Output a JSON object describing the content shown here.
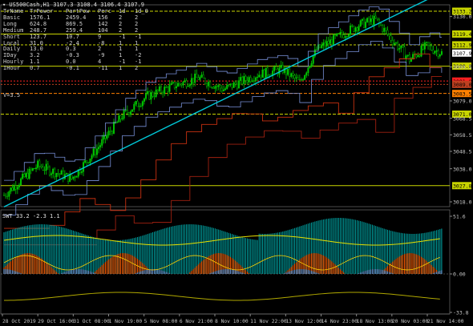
{
  "window": {
    "title": "▾ US500Cash,H1  3107.3 3108.4 3106.4 3107.9"
  },
  "info_table": {
    "headers": [
      "TrName",
      "TrPower",
      "PartPow",
      "Perc",
      "1d",
      "1d_0"
    ],
    "rows": [
      [
        "Basic",
        "1576.1",
        "2459.4",
        "156",
        "2",
        "2"
      ],
      [
        "Long",
        "624.8",
        "869.5",
        "142",
        "2",
        "2"
      ],
      [
        "Medium",
        "248.7",
        "259.4",
        "104",
        "2",
        "2"
      ],
      [
        "Short",
        "123.7",
        "10.7",
        "9",
        "-1",
        "-1"
      ],
      [
        "Local",
        "31.0",
        "-2.4",
        "-8",
        "1",
        "1"
      ],
      [
        "Daily",
        "13.0",
        "0.3",
        "2",
        "1",
        "1"
      ],
      [
        "IDay",
        "3.2",
        "-0.3",
        "-9",
        "1",
        "-2"
      ],
      [
        "Hourly",
        "1.1",
        "0.0",
        "4",
        "-1",
        "-1"
      ],
      [
        "IHour",
        "0.7",
        "-0.1",
        "-11",
        "1",
        "2"
      ]
    ],
    "footer": "V=3.5"
  },
  "price_labels": [
    {
      "text": "3133.2",
      "color": "#c8d400",
      "kind": "box"
    },
    {
      "text": "3130.0",
      "color": "#c8c8c8",
      "kind": "plain"
    },
    {
      "text": "3119.4",
      "color": "#c8d400",
      "kind": "box"
    },
    {
      "text": "3112.9",
      "color": "#c8d400",
      "kind": "box"
    },
    {
      "text": "3107.9",
      "color": "#ffffff",
      "kind": "box"
    },
    {
      "text": "3100.0",
      "color": "#c8d400",
      "kind": "box"
    },
    {
      "text": "3099.5",
      "color": "#c8c8c8",
      "kind": "plain"
    },
    {
      "text": "3091.0",
      "color": "#ff2020",
      "kind": "box"
    },
    {
      "text": "3089.0",
      "color": "#c04020",
      "kind": "box"
    },
    {
      "text": "3083.5",
      "color": "#ff8000",
      "kind": "box"
    },
    {
      "text": "3079.0",
      "color": "#c8c8c8",
      "kind": "plain"
    },
    {
      "text": "3071.0",
      "color": "#c8d400",
      "kind": "box"
    },
    {
      "text": "3068.5",
      "color": "#c8c8c8",
      "kind": "plain"
    },
    {
      "text": "3058.5",
      "color": "#c8c8c8",
      "kind": "plain"
    },
    {
      "text": "3048.5",
      "color": "#c8c8c8",
      "kind": "plain"
    },
    {
      "text": "3038.0",
      "color": "#c8c8c8",
      "kind": "plain"
    },
    {
      "text": "3027.8",
      "color": "#c8d400",
      "kind": "box"
    },
    {
      "text": "3018.0",
      "color": "#c8c8c8",
      "kind": "plain"
    }
  ],
  "indicator": {
    "label": "SWT 33.2 -2.3 1.1",
    "scale_labels": [
      "51.6",
      "0.00",
      "-33.8"
    ]
  },
  "time_axis": [
    "28 Oct 2019",
    "29 Oct 16:00",
    "31 Oct 08:00",
    "1 Nov 19:00",
    "5 Nov 08:00",
    "6 Nov 21:00",
    "8 Nov 10:00",
    "11 Nov 22:00",
    "13 Nov 12:00",
    "14 Nov 23:00",
    "18 Nov 13:00",
    "20 Nov 03:00",
    "21 Nov 14:00"
  ],
  "colors": {
    "background": "#000000",
    "candles": "#00c800",
    "accent_yellow": "#c8d400",
    "cyan": "#00c8d8",
    "blue_band": "#7890d8",
    "red_band": "#c83010",
    "hist_teal": "#00a0a0",
    "hist_orange": "#ff5a00",
    "hist_blue": "#6a98d8"
  }
}
